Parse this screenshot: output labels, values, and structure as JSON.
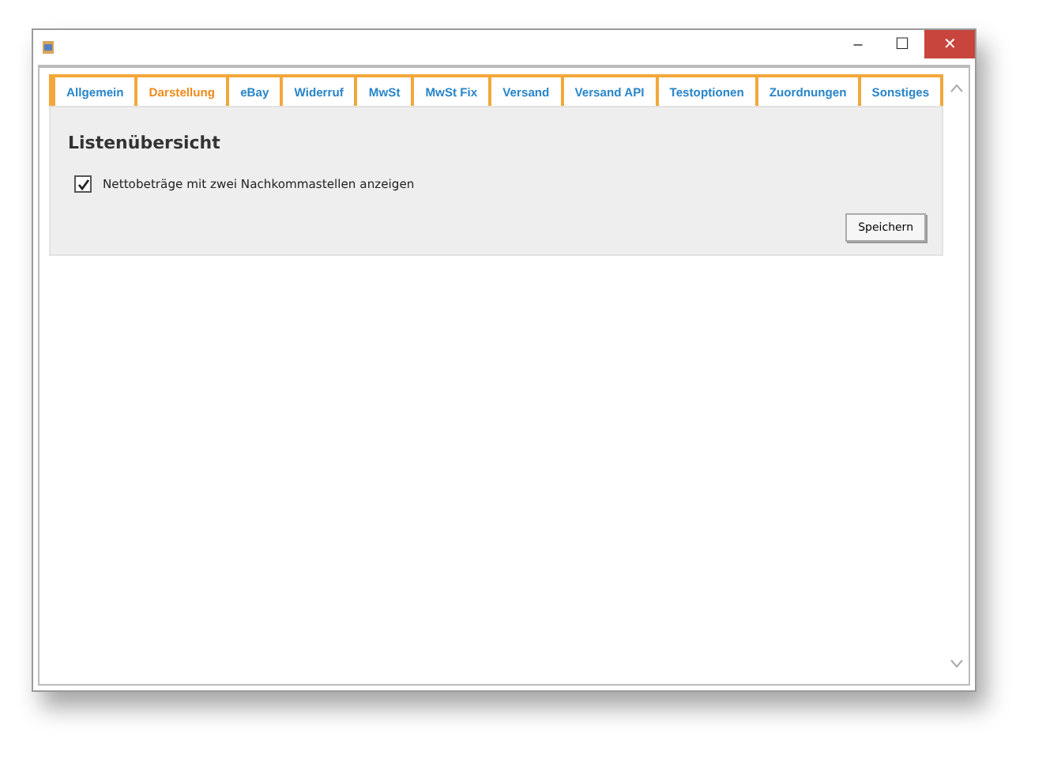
{
  "window": {
    "controls": [
      "–",
      "☐",
      "✕"
    ]
  },
  "tabs": [
    {
      "label": "Allgemein",
      "selected": false
    },
    {
      "label": "Darstellung",
      "selected": true
    },
    {
      "label": "eBay",
      "selected": false
    },
    {
      "label": "Widerruf",
      "selected": false
    },
    {
      "label": "MwSt",
      "selected": false
    },
    {
      "label": "MwSt Fix",
      "selected": false
    },
    {
      "label": "Versand",
      "selected": false
    },
    {
      "label": "Versand API",
      "selected": false
    },
    {
      "label": "Testoptionen",
      "selected": false
    },
    {
      "label": "Zuordnungen",
      "selected": false
    },
    {
      "label": "Sonstiges",
      "selected": false
    }
  ],
  "section": {
    "title": "Listenübersicht",
    "options": [
      {
        "label": "Nettobeträge mit zwei Nachkommastellen anzeigen",
        "checked": true
      }
    ],
    "save_button": "Speichern"
  }
}
